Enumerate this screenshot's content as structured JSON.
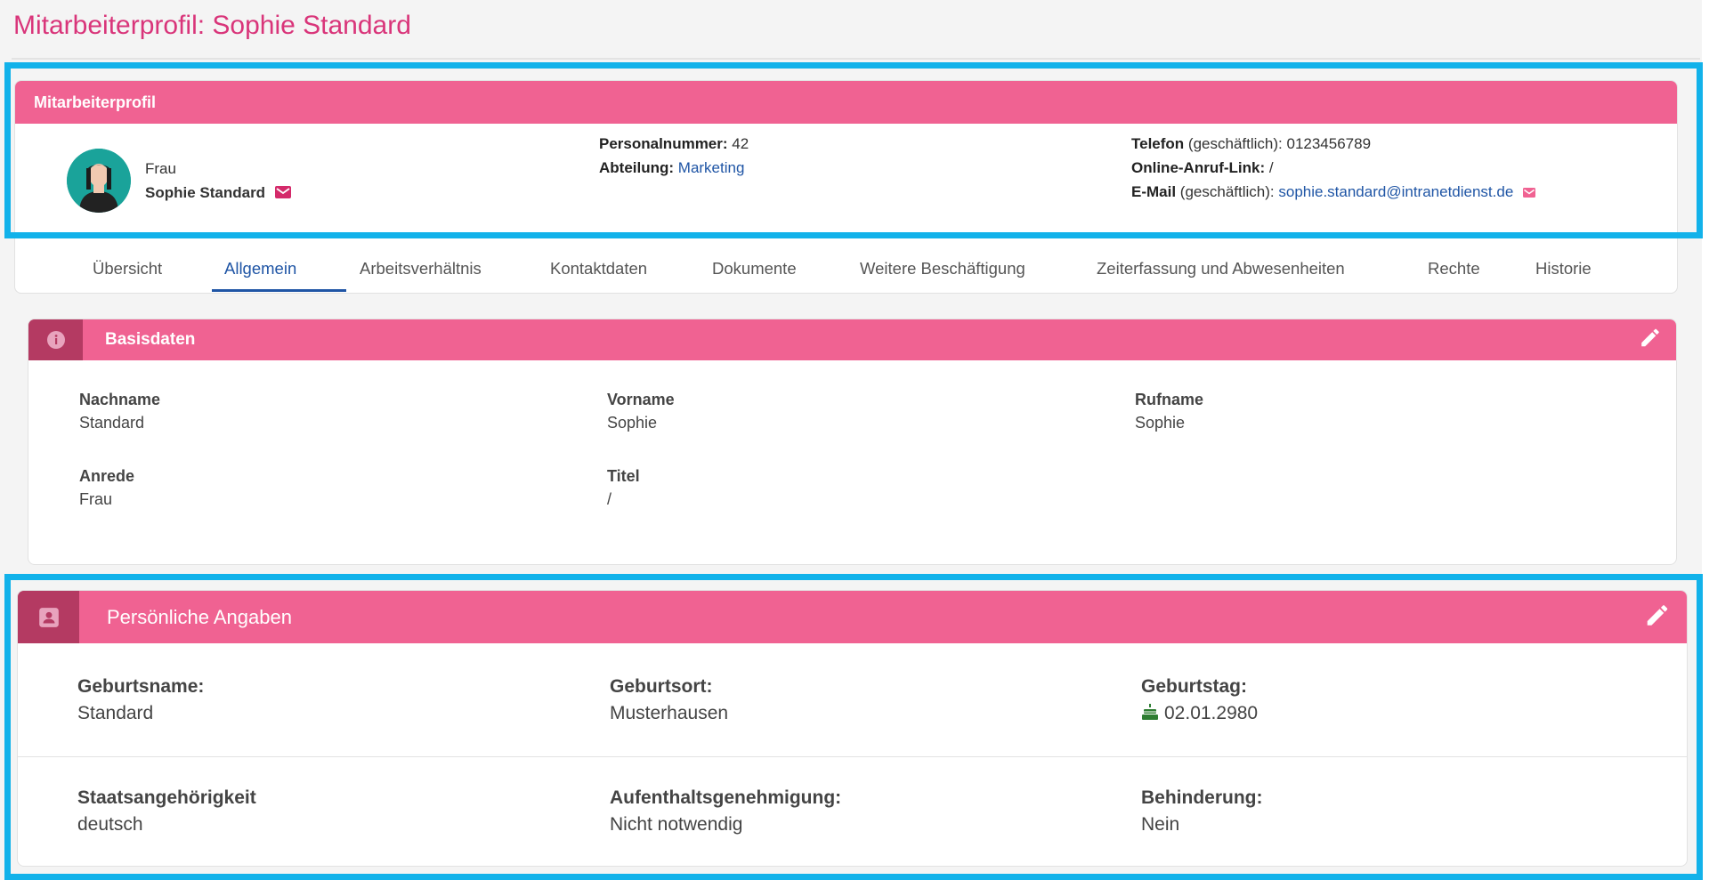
{
  "page": {
    "title": "Mitarbeiterprofil: Sophie Standard"
  },
  "profile": {
    "header": "Mitarbeiterprofil",
    "salutation": "Frau",
    "name": "Sophie Standard",
    "personalnummer_label": "Personalnummer:",
    "personalnummer": "42",
    "abteilung_label": "Abteilung:",
    "abteilung": "Marketing",
    "telefon_label": "Telefon",
    "telefon_note": "(geschäftlich):",
    "telefon": "0123456789",
    "online_label": "Online-Anruf-Link:",
    "online_value": "/",
    "email_label": "E-Mail",
    "email_note": "(geschäftlich):",
    "email": "sophie.standard@intranetdienst.de",
    "icons": [
      "avatar-icon",
      "mail-icon"
    ]
  },
  "tabs": [
    {
      "label": "Übersicht"
    },
    {
      "label": "Allgemein",
      "active": true
    },
    {
      "label": "Arbeitsverhältnis"
    },
    {
      "label": "Kontaktdaten"
    },
    {
      "label": "Dokumente"
    },
    {
      "label": "Weitere Beschäftigung"
    },
    {
      "label": "Zeiterfassung und Abwesenheiten"
    },
    {
      "label": "Rechte"
    },
    {
      "label": "Historie"
    }
  ],
  "basisdaten": {
    "title": "Basisdaten",
    "icon": "info-icon",
    "fields": [
      {
        "label": "Nachname",
        "value": "Standard"
      },
      {
        "label": "Vorname",
        "value": "Sophie"
      },
      {
        "label": "Rufname",
        "value": "Sophie"
      },
      {
        "label": "Anrede",
        "value": "Frau"
      },
      {
        "label": "Titel",
        "value": "/"
      }
    ]
  },
  "persoenlich": {
    "title": "Persönliche Angaben",
    "icon": "contact-card-icon",
    "fields": [
      {
        "label": "Geburtsname:",
        "value": "Standard"
      },
      {
        "label": "Geburtsort:",
        "value": "Musterhausen"
      },
      {
        "label": "Geburtstag:",
        "value": "02.01.2980",
        "icon": "cake-icon"
      },
      {
        "label": "Staatsangehörigkeit",
        "value": "deutsch"
      },
      {
        "label": "Aufenthaltsgenehmigung:",
        "value": "Nicht notwendig"
      },
      {
        "label": "Behinderung:",
        "value": "Nein"
      }
    ]
  },
  "colors": {
    "accent_pink": "#f06292",
    "title_pink": "#d9357a",
    "icon_box": "#b43a62",
    "link_blue": "#1f55a5",
    "highlight": "#12b2ea"
  }
}
